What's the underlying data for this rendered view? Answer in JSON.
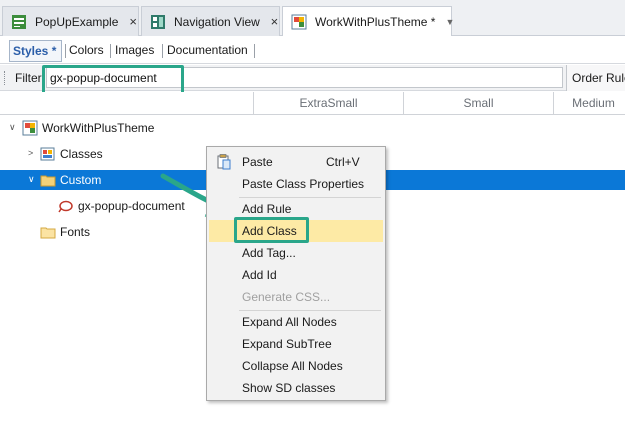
{
  "doc_tabs": [
    {
      "label": "PopUpExample",
      "close": "×"
    },
    {
      "label": "Navigation View",
      "close": "×"
    },
    {
      "label": "WorkWithPlusTheme *",
      "close": "▼"
    }
  ],
  "sub_tabs": [
    {
      "label": "Styles *"
    },
    {
      "label": "Colors"
    },
    {
      "label": "Images"
    },
    {
      "label": "Documentation"
    }
  ],
  "filter": {
    "label": "Filter",
    "value": "gx-popup-document"
  },
  "order_rules_label": "Order Rules",
  "columns": [
    "ExtraSmall",
    "Small",
    "Medium"
  ],
  "tree": {
    "root": {
      "label": "WorkWithPlusTheme",
      "expander": "∨"
    },
    "classes": {
      "label": "Classes",
      "expander": ">"
    },
    "custom": {
      "label": "Custom",
      "expander": "∨"
    },
    "gx_popup": {
      "label": "gx-popup-document"
    },
    "fonts": {
      "label": "Fonts"
    }
  },
  "context_menu": {
    "paste": {
      "label": "Paste",
      "shortcut": "Ctrl+V"
    },
    "paste_class_properties": {
      "label": "Paste Class Properties"
    },
    "add_rule": {
      "label": "Add Rule"
    },
    "add_class": {
      "label": "Add Class"
    },
    "add_tag": {
      "label": "Add Tag..."
    },
    "add_id": {
      "label": "Add Id"
    },
    "generate_css": {
      "label": "Generate CSS...",
      "disabled": true
    },
    "expand_all": {
      "label": "Expand All Nodes"
    },
    "expand_subtree": {
      "label": "Expand SubTree"
    },
    "collapse_all": {
      "label": "Collapse All Nodes"
    },
    "show_sd": {
      "label": "Show SD classes"
    }
  },
  "colors": {
    "selection": "#0b78d7",
    "highlight_border": "#2aa68a",
    "menu_hover": "#fdeaa5",
    "active_subtab": "#2b5ea9"
  }
}
